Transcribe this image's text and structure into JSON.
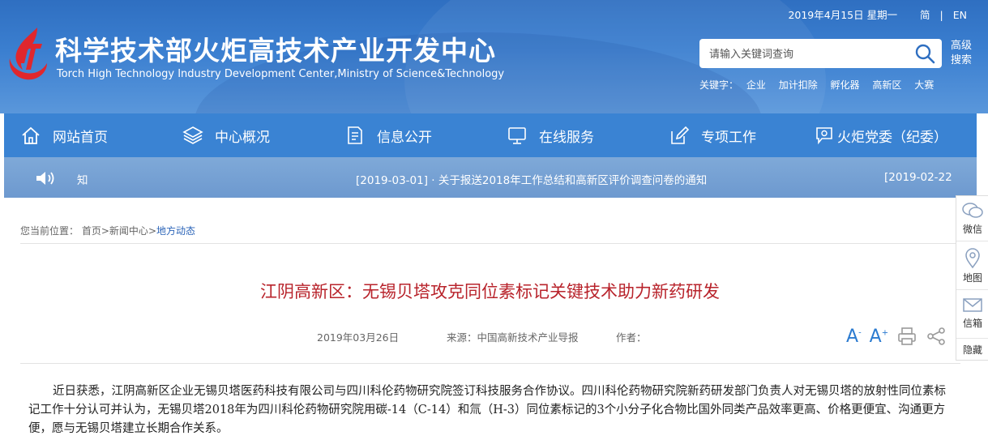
{
  "header": {
    "date": "2019年4月15日 星期一",
    "lang_simplified": "简",
    "lang_english": "EN",
    "site_title": "科学技术部火炬高技术产业开发中心",
    "site_subtitle": "Torch High Technology Industry Development Center,Ministry of Science&Technology",
    "search_placeholder": "请输入关键词查询",
    "advanced_search": "高级搜索",
    "keywords_label": "关键字：",
    "keywords": [
      "企业",
      "加计扣除",
      "孵化器",
      "高新区",
      "大赛"
    ]
  },
  "nav": {
    "items": [
      {
        "label": "网站首页",
        "icon": "home-icon"
      },
      {
        "label": "中心概况",
        "icon": "layers-icon"
      },
      {
        "label": "信息公开",
        "icon": "document-icon"
      },
      {
        "label": "在线服务",
        "icon": "monitor-icon"
      },
      {
        "label": "专项工作",
        "icon": "edit-icon"
      },
      {
        "label": "火炬党委（纪委）",
        "icon": "party-icon"
      }
    ]
  },
  "notice": {
    "label": "知",
    "item1": "[2019-03-01] · 关于报送2018年工作总结和高新区评价调查问卷的通知",
    "item2": "[2019-02-22]"
  },
  "breadcrumb": {
    "prefix": "您当前位置：",
    "home": "首页",
    "sep": ">",
    "news": "新闻中心",
    "current": "地方动态"
  },
  "article": {
    "title": "江阴高新区：无锡贝塔攻克同位素标记关键技术助力新药研发",
    "date": "2019年03月26日",
    "source": "来源：中国高新技术产业导报",
    "author": "作者：",
    "font_larger": "A",
    "font_smaller": "A",
    "body": "近日获悉，江阴高新区企业无锡贝塔医药科技有限公司与四川科伦药物研究院签订科技服务合作协议。四川科伦药物研究院新药研发部门负责人对无锡贝塔的放射性同位素标记工作十分认可并认为，无锡贝塔2018年为四川科伦药物研究院用碳-14（C-14）和氚（H-3）同位素标记的3个小分子化合物比国外同类产品效率更高、价格更便宜、沟通更方便，愿与无锡贝塔建立长期合作关系。"
  },
  "sidebar": {
    "wechat": "微信",
    "map": "地图",
    "mailbox": "信箱",
    "hide": "隐藏"
  },
  "colors": {
    "nav_bg": "#3a83d3",
    "title_red": "#b8232b",
    "link_blue": "#2b64b8"
  }
}
